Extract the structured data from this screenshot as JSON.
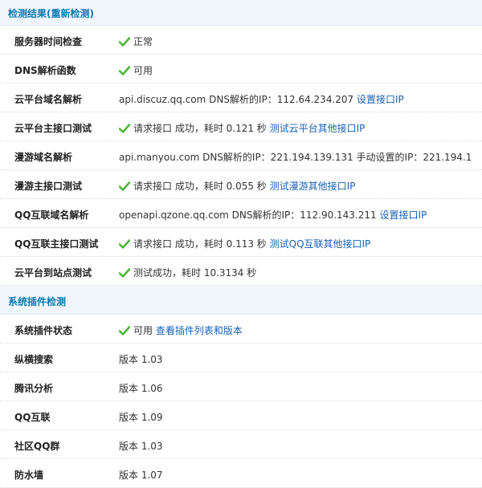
{
  "section_result": {
    "title": "检测结果(重新检测)"
  },
  "checks": [
    {
      "label": "服务器时间检查",
      "icon": "check",
      "text": "正常",
      "link": ""
    },
    {
      "label": "DNS解析函数",
      "icon": "check",
      "text": "可用",
      "link": ""
    },
    {
      "label": "云平台域名解析",
      "icon": "",
      "text": "api.discuz.qq.com DNS解析的IP：112.64.234.207 ",
      "link": "设置接口IP"
    },
    {
      "label": "云平台主接口测试",
      "icon": "check",
      "text": "请求接口 成功，耗时 0.121 秒 ",
      "link": "测试云平台其他接口IP"
    },
    {
      "label": "漫游域名解析",
      "icon": "",
      "text": "api.manyou.com DNS解析的IP：221.194.139.131 手动设置的IP：221.194.1",
      "link": ""
    },
    {
      "label": "漫游主接口测试",
      "icon": "check",
      "text": "请求接口 成功，耗时 0.055 秒 ",
      "link": "测试漫游其他接口IP"
    },
    {
      "label": "QQ互联域名解析",
      "icon": "",
      "text": "openapi.qzone.qq.com DNS解析的IP：112.90.143.211 ",
      "link": "设置接口IP"
    },
    {
      "label": "QQ互联主接口测试",
      "icon": "check",
      "text": "请求接口 成功，耗时 0.113 秒 ",
      "link": "测试QQ互联其他接口IP"
    },
    {
      "label": "云平台到站点测试",
      "icon": "check",
      "text": "测试成功，耗时 10.3134 秒",
      "link": ""
    }
  ],
  "section_plugin": {
    "title": "系统插件检测"
  },
  "plugins": [
    {
      "label": "系统插件状态",
      "icon": "check",
      "text": "可用 ",
      "link": "查看插件列表和版本"
    },
    {
      "label": "纵横搜索",
      "icon": "",
      "text": "版本 1.03",
      "link": ""
    },
    {
      "label": "腾讯分析",
      "icon": "",
      "text": "版本 1.06",
      "link": ""
    },
    {
      "label": "QQ互联",
      "icon": "",
      "text": "版本 1.09",
      "link": ""
    },
    {
      "label": "社区QQ群",
      "icon": "",
      "text": "版本 1.03",
      "link": ""
    },
    {
      "label": "防水墙",
      "icon": "",
      "text": "版本 1.07",
      "link": ""
    }
  ],
  "colors": {
    "section_bg": "#f1f6fa",
    "section_title": "#0a79b6",
    "link": "#1760b5",
    "check": "#52b43a"
  }
}
